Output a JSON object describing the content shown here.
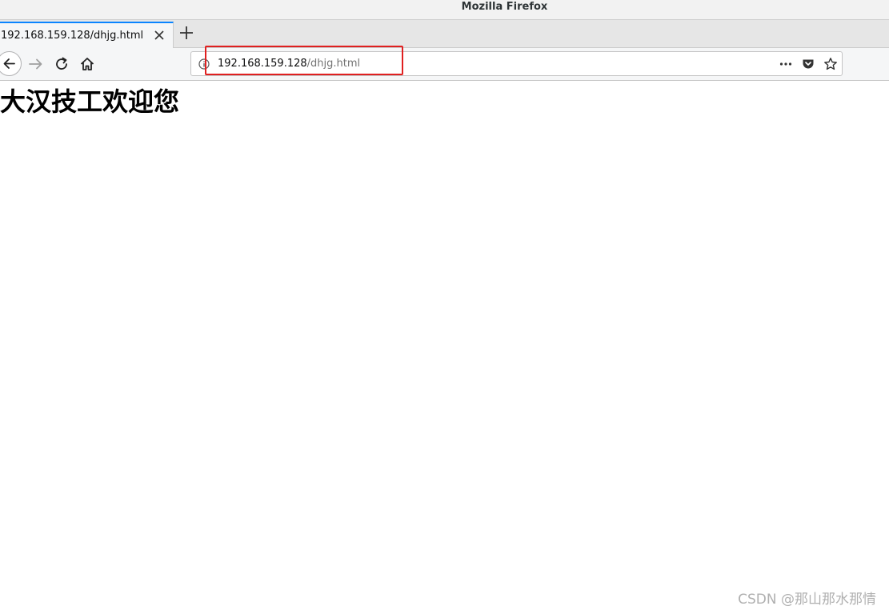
{
  "window": {
    "title": "Mozilla Firefox"
  },
  "tabs": [
    {
      "label": "192.168.159.128/dhjg.html",
      "active": true
    }
  ],
  "urlbar": {
    "host": "192.168.159.128",
    "path": "/dhjg.html"
  },
  "page": {
    "heading": "大汉技工欢迎您"
  },
  "watermark": "CSDN @那山那水那情",
  "colors": {
    "active_tab_accent": "#0a84ff",
    "highlight_box": "#e02020"
  },
  "icons": {
    "back": "back-arrow-icon",
    "forward": "forward-arrow-icon",
    "reload": "reload-icon",
    "home": "home-icon",
    "info": "info-icon",
    "page_actions": "more-dots-icon",
    "pocket": "pocket-icon",
    "bookmark": "star-icon",
    "close_tab": "close-icon",
    "new_tab": "plus-icon"
  }
}
